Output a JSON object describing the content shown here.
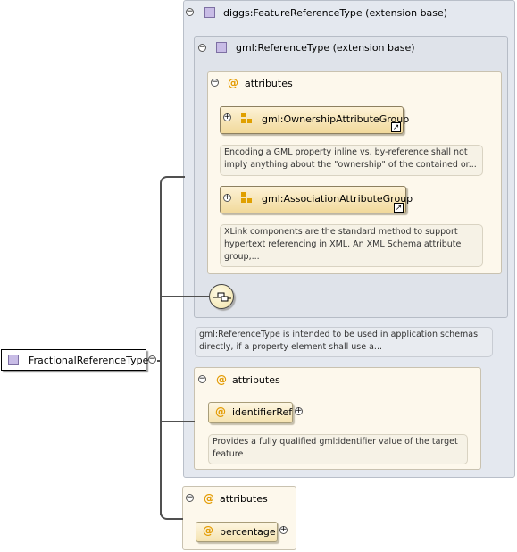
{
  "root": {
    "label": "FractionalReferenceType"
  },
  "ext_base": {
    "label": "diggs:FeatureReferenceType (extension base)"
  },
  "inner_ext": {
    "label": "gml:ReferenceType (extension base)"
  },
  "attrs_inner": {
    "label": "attributes",
    "groups": [
      {
        "label": "gml:OwnershipAttributeGroup",
        "note_lines": [
          "Encoding a GML property inline vs. by-reference shall not",
          "imply anything about the \"ownership\" of the contained or..."
        ]
      },
      {
        "label": "gml:AssociationAttributeGroup",
        "note_lines": [
          "XLink components are the standard method to support",
          "hypertext referencing in XML. An XML Schema attribute",
          "group,..."
        ]
      }
    ]
  },
  "inner_ext_note": {
    "lines": [
      "gml:ReferenceType is intended to be used in application schemas",
      "directly, if a property element shall use a..."
    ]
  },
  "attrs_ext": {
    "label": "attributes",
    "item": "identifierRef",
    "note_lines": [
      "Provides a fully qualified gml:identifier value of the target",
      "feature"
    ]
  },
  "attrs_root": {
    "label": "attributes",
    "item": "percentage"
  },
  "colors": {
    "grey_panel": "#e4e8ef",
    "yellow_panel": "#fdf8ec",
    "accent": "#e39a00"
  }
}
